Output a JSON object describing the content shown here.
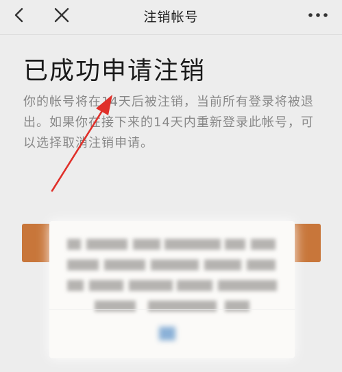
{
  "nav": {
    "title": "注销帐号",
    "back_icon": "chevron-left-icon",
    "close_icon": "close-icon",
    "more_icon": "more-icon"
  },
  "main": {
    "title": "已成功申请注销",
    "description": "你的帐号将在14天后被注销，当前所有登录将被退出。如果你在接下来的14天内重新登录此帐号，可以选择取消注销申请。"
  },
  "colors": {
    "background": "#ededed",
    "arrow": "#e0302a",
    "orange_bar": "#c8763a"
  }
}
